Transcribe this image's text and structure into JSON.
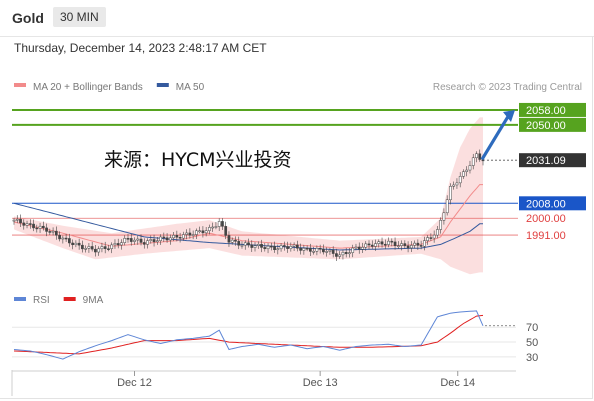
{
  "header": {
    "instrument": "Gold",
    "interval": "30 MIN"
  },
  "datetime": "Thursday, December 14, 2023 2:48:17 AM CET",
  "credit": "Research © 2023 Trading Central",
  "annotation": "来源：HYCM兴业投资",
  "colors": {
    "bollinger": "#f28b8b",
    "ma50": "#355a9e",
    "target": "#56a31f",
    "pivot": "#1a56c8",
    "support": "#e04040",
    "candle": "#444444",
    "rsi": "#5e86d6",
    "rsi_ma": "#e02020",
    "arrow": "#2e6bbd"
  },
  "chart_data": [
    {
      "type": "line",
      "subtype": "candlestick",
      "legend": [
        {
          "name": "MA 20 + Bollinger Bands",
          "color": "#f28b8b"
        },
        {
          "name": "MA 50",
          "color": "#355a9e"
        }
      ],
      "legend_position": "top-left",
      "x_ticks": [
        "Dec 12",
        "Dec 13",
        "Dec 14"
      ],
      "ylim": [
        1968,
        2066
      ],
      "levels": [
        {
          "label": "2058.00",
          "value": 2058.0,
          "kind": "target"
        },
        {
          "label": "2050.00",
          "value": 2050.0,
          "kind": "target"
        },
        {
          "label": "2031.09",
          "value": 2031.09,
          "kind": "current"
        },
        {
          "label": "2008.00",
          "value": 2008.0,
          "kind": "pivot"
        },
        {
          "label": "2000.00",
          "value": 2000.0,
          "kind": "support"
        },
        {
          "label": "1991.00",
          "value": 1991.0,
          "kind": "support"
        }
      ],
      "close_path": [
        [
          0,
          1999
        ],
        [
          5,
          1996
        ],
        [
          10,
          1994
        ],
        [
          15,
          1989
        ],
        [
          20,
          1985
        ],
        [
          25,
          1983
        ],
        [
          30,
          1985
        ],
        [
          35,
          1989
        ],
        [
          40,
          1987
        ],
        [
          45,
          1989
        ],
        [
          50,
          1990
        ],
        [
          55,
          1992
        ],
        [
          60,
          1994
        ],
        [
          63,
          1998
        ],
        [
          66,
          1988
        ],
        [
          70,
          1986
        ],
        [
          75,
          1985
        ],
        [
          80,
          1984
        ],
        [
          85,
          1985
        ],
        [
          90,
          1983
        ],
        [
          95,
          1983
        ],
        [
          100,
          1980
        ],
        [
          105,
          1984
        ],
        [
          110,
          1986
        ],
        [
          115,
          1987
        ],
        [
          120,
          1985
        ],
        [
          125,
          1986
        ],
        [
          130,
          1993
        ],
        [
          132,
          2004
        ],
        [
          134,
          2016
        ],
        [
          136,
          2020
        ],
        [
          138,
          2024
        ],
        [
          140,
          2029
        ],
        [
          142,
          2034
        ],
        [
          144,
          2031
        ]
      ],
      "bollinger_upper": [
        [
          0,
          2001
        ],
        [
          15,
          1996
        ],
        [
          30,
          1992
        ],
        [
          50,
          1997
        ],
        [
          60,
          1999
        ],
        [
          70,
          1993
        ],
        [
          100,
          1988
        ],
        [
          125,
          1990
        ],
        [
          131,
          2000
        ],
        [
          134,
          2022
        ],
        [
          137,
          2038
        ],
        [
          140,
          2048
        ],
        [
          143,
          2054
        ]
      ],
      "bollinger_lower": [
        [
          0,
          1994
        ],
        [
          15,
          1984
        ],
        [
          25,
          1978
        ],
        [
          40,
          1981
        ],
        [
          60,
          1984
        ],
        [
          70,
          1980
        ],
        [
          100,
          1978
        ],
        [
          125,
          1981
        ],
        [
          131,
          1978
        ],
        [
          134,
          1974
        ],
        [
          137,
          1972
        ],
        [
          140,
          1970
        ],
        [
          143,
          1971
        ]
      ],
      "ma20": [
        [
          0,
          1998
        ],
        [
          15,
          1992
        ],
        [
          30,
          1985
        ],
        [
          50,
          1988
        ],
        [
          60,
          1992
        ],
        [
          70,
          1988
        ],
        [
          100,
          1984
        ],
        [
          125,
          1986
        ],
        [
          131,
          1990
        ],
        [
          134,
          1998
        ],
        [
          137,
          2005
        ],
        [
          140,
          2012
        ],
        [
          143,
          2018
        ]
      ],
      "ma50": [
        [
          0,
          2008
        ],
        [
          20,
          1999
        ],
        [
          40,
          1990
        ],
        [
          60,
          1987
        ],
        [
          80,
          1985
        ],
        [
          100,
          1983
        ],
        [
          125,
          1984
        ],
        [
          131,
          1986
        ],
        [
          135,
          1989
        ],
        [
          140,
          1993
        ],
        [
          143,
          1997
        ]
      ]
    },
    {
      "type": "line",
      "legend": [
        {
          "name": "RSI",
          "color": "#5e86d6"
        },
        {
          "name": "9MA",
          "color": "#e02020"
        }
      ],
      "ylim": [
        15,
        100
      ],
      "y_ticks": [
        30,
        50,
        70
      ],
      "rsi": [
        [
          0,
          40
        ],
        [
          5,
          38
        ],
        [
          10,
          33
        ],
        [
          15,
          27
        ],
        [
          20,
          37
        ],
        [
          25,
          45
        ],
        [
          30,
          52
        ],
        [
          35,
          60
        ],
        [
          40,
          53
        ],
        [
          45,
          48
        ],
        [
          50,
          53
        ],
        [
          55,
          55
        ],
        [
          60,
          58
        ],
        [
          63,
          66
        ],
        [
          66,
          40
        ],
        [
          70,
          44
        ],
        [
          75,
          47
        ],
        [
          80,
          43
        ],
        [
          85,
          46
        ],
        [
          90,
          41
        ],
        [
          95,
          44
        ],
        [
          100,
          39
        ],
        [
          105,
          44
        ],
        [
          110,
          46
        ],
        [
          115,
          47
        ],
        [
          120,
          44
        ],
        [
          125,
          46
        ],
        [
          130,
          84
        ],
        [
          134,
          89
        ],
        [
          138,
          91
        ],
        [
          142,
          92
        ],
        [
          144,
          72
        ]
      ],
      "rsi_ma": [
        [
          0,
          38
        ],
        [
          10,
          36
        ],
        [
          20,
          34
        ],
        [
          30,
          42
        ],
        [
          40,
          52
        ],
        [
          50,
          52
        ],
        [
          60,
          55
        ],
        [
          66,
          50
        ],
        [
          75,
          48
        ],
        [
          90,
          45
        ],
        [
          100,
          43
        ],
        [
          110,
          43
        ],
        [
          125,
          45
        ],
        [
          130,
          50
        ],
        [
          134,
          62
        ],
        [
          138,
          75
        ],
        [
          142,
          85
        ],
        [
          144,
          86
        ]
      ]
    }
  ]
}
